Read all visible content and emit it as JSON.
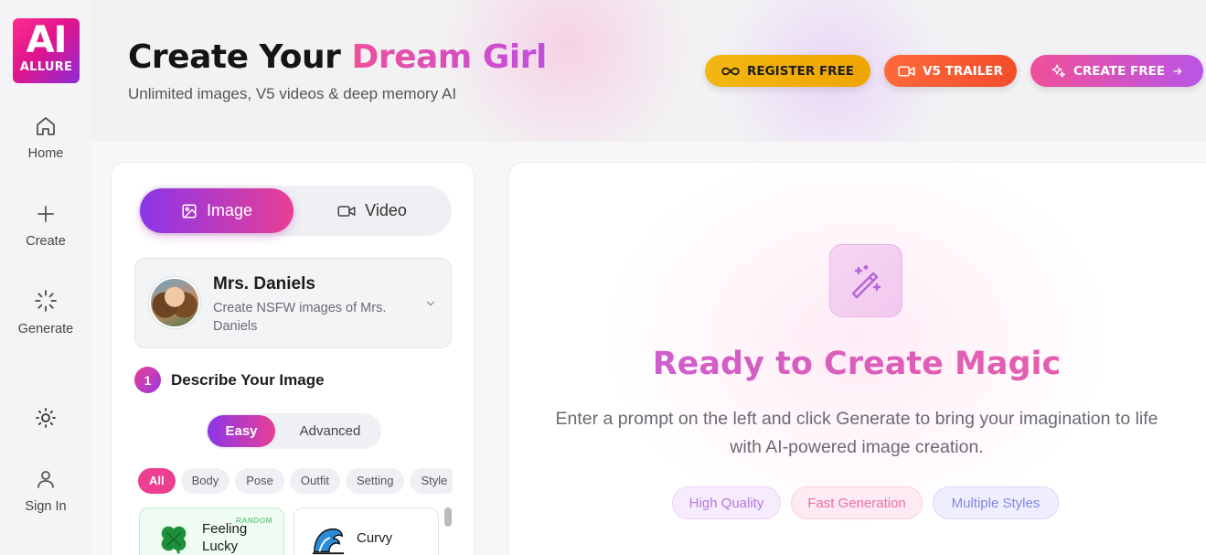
{
  "brand": {
    "logo_main": "AI",
    "logo_sub": "ALLURE"
  },
  "sidebar": {
    "items": [
      {
        "label": "Home",
        "icon": "home-icon"
      },
      {
        "label": "Create",
        "icon": "plus-icon"
      },
      {
        "label": "Generate",
        "icon": "loader-icon"
      },
      {
        "label": "",
        "icon": "sun-icon"
      },
      {
        "label": "Sign In",
        "icon": "user-icon"
      }
    ]
  },
  "header": {
    "title_prefix": "Create Your ",
    "title_accent": "Dream Girl",
    "subtitle": "Unlimited images, V5 videos & deep memory AI",
    "buttons": {
      "register": "REGISTER FREE",
      "trailer": "V5 TRAILER",
      "create": "CREATE FREE"
    }
  },
  "left_panel": {
    "media_tabs": {
      "image": "Image",
      "video": "Video",
      "selected": "Image"
    },
    "character": {
      "name": "Mrs. Daniels",
      "description": "Create NSFW images of Mrs. Daniels"
    },
    "step": {
      "number": "1",
      "title": "Describe Your Image"
    },
    "mode": {
      "easy": "Easy",
      "advanced": "Advanced",
      "selected": "Easy"
    },
    "categories": [
      "All",
      "Body",
      "Pose",
      "Outfit",
      "Setting",
      "Style"
    ],
    "selected_category": "All",
    "preset_cards": [
      {
        "label": "Feeling Lucky",
        "badge": "RANDOM",
        "icon": "clover-icon"
      },
      {
        "label": "Curvy",
        "icon": "wave-icon"
      }
    ]
  },
  "right_panel": {
    "title": "Ready to Create Magic",
    "description": "Enter a prompt on the left and click Generate to bring your imagination to life with AI-powered image creation.",
    "features": [
      "High Quality",
      "Fast Generation",
      "Multiple Styles"
    ]
  },
  "colors": {
    "accent_pink": "#ec3f8f",
    "accent_purple": "#8a36e8",
    "register_yellow": "#f3b711",
    "trailer_orange": "#f24d2a"
  }
}
